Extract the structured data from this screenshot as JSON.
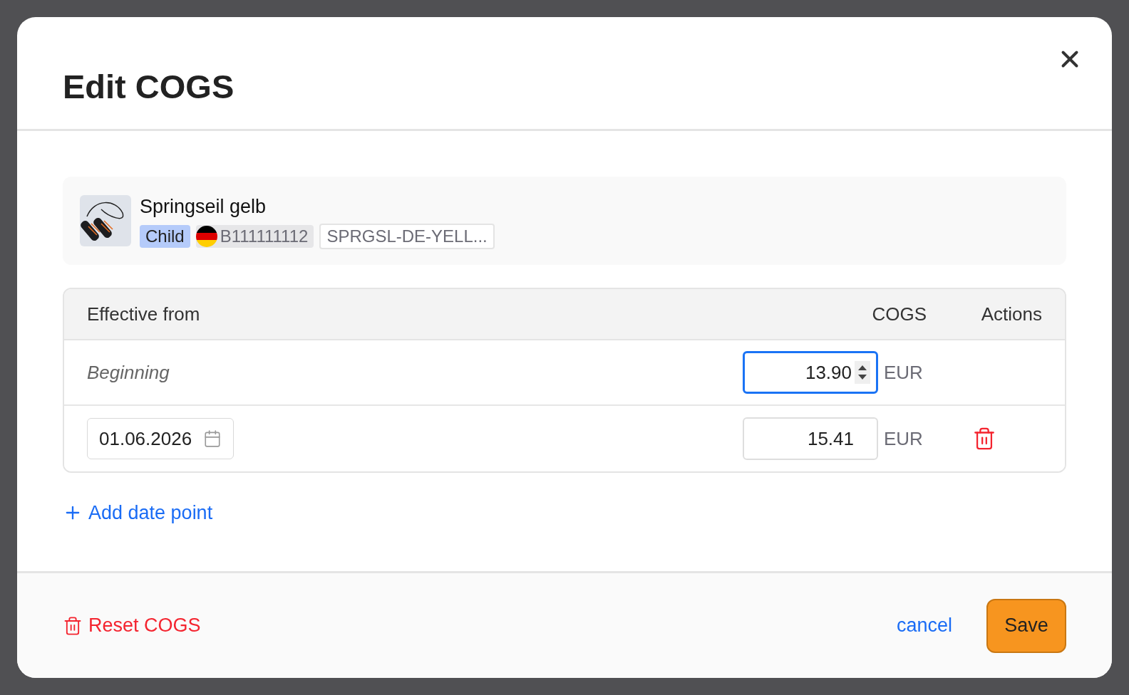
{
  "dialog": {
    "title": "Edit COGS"
  },
  "product": {
    "name": "Springseil gelb",
    "badge": "Child",
    "asin": "B111111112",
    "sku": "SPRGSL-DE-YELL..."
  },
  "table": {
    "columns": [
      "Effective from",
      "COGS",
      "Actions"
    ],
    "rows": [
      {
        "kind": "fixed",
        "from": "Beginning",
        "value": "13.90",
        "currency": "EUR",
        "focused": true,
        "deletable": false
      },
      {
        "kind": "date",
        "from": "01.06.2026",
        "value": "15.41",
        "currency": "EUR",
        "focused": false,
        "deletable": true
      }
    ]
  },
  "add_link": "Add date point",
  "footer": {
    "reset": "Reset COGS",
    "cancel": "cancel",
    "save": "Save"
  }
}
